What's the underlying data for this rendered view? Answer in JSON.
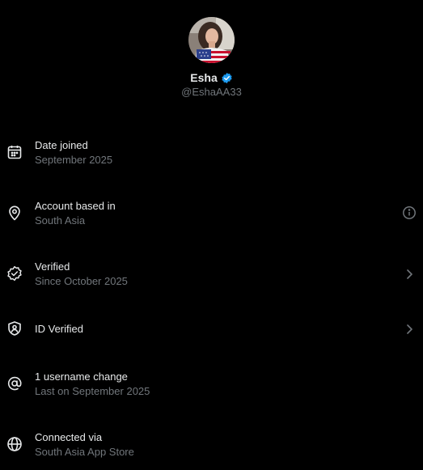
{
  "profile": {
    "name": "Esha",
    "handle": "@EshaAA33",
    "verified_badge_color": "#1d9bf0"
  },
  "items": [
    {
      "icon": "calendar-icon",
      "title": "Date joined",
      "subtitle": "September 2025"
    },
    {
      "icon": "location-pin-icon",
      "title": "Account based in",
      "subtitle": "South Asia",
      "trailing": "info-icon"
    },
    {
      "icon": "verified-seal-icon",
      "title": "Verified",
      "subtitle": "Since October 2025",
      "trailing": "chevron-right-icon"
    },
    {
      "icon": "id-shield-icon",
      "title": "ID Verified",
      "trailing": "chevron-right-icon"
    },
    {
      "icon": "at-sign-icon",
      "title": "1 username change",
      "subtitle": "Last on September 2025"
    },
    {
      "icon": "globe-icon",
      "title": "Connected via",
      "subtitle": "South Asia App Store"
    }
  ],
  "colors": {
    "background": "#000000",
    "primary_text": "#e7e9ea",
    "secondary_text": "#71767b",
    "accent": "#1d9bf0"
  }
}
